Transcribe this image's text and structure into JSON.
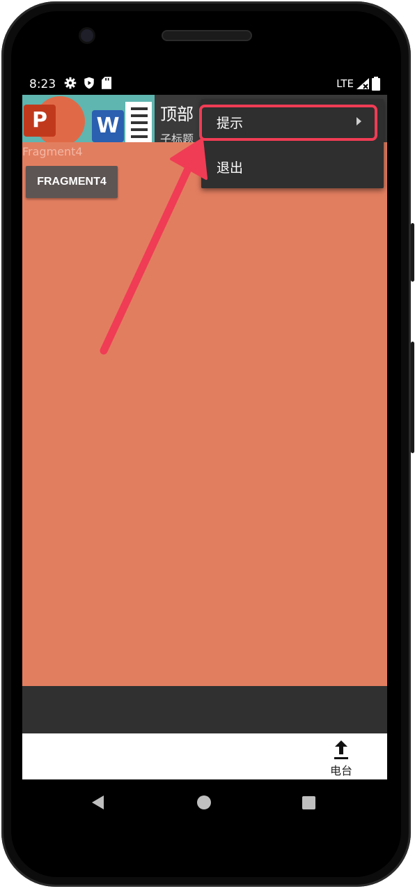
{
  "status_bar": {
    "time": "8:23",
    "left_icons": [
      "gear-icon",
      "shield-icon",
      "sd-card-icon"
    ],
    "network": "LTE",
    "right_icons": [
      "signal-icon",
      "battery-icon"
    ]
  },
  "toolbar": {
    "title": "顶部",
    "subtitle": "子标题",
    "logo_letters": {
      "powerpoint": "P",
      "word": "W"
    }
  },
  "content": {
    "fragment_label": "Fragment4",
    "fragment_button_label": "FRAGMENT4",
    "background_color": "#e27e60"
  },
  "overflow_menu": {
    "items": [
      {
        "label": "提示",
        "has_submenu": true
      },
      {
        "label": "退出",
        "has_submenu": false
      }
    ]
  },
  "bottom_nav": {
    "item_label": "电台",
    "item_icon": "upload-arrow-icon"
  },
  "annotation": {
    "highlight_color": "#f03c55",
    "arrow_color": "#f03c55"
  },
  "android_nav": {
    "buttons": [
      "back-icon",
      "home-icon",
      "recents-icon"
    ]
  }
}
